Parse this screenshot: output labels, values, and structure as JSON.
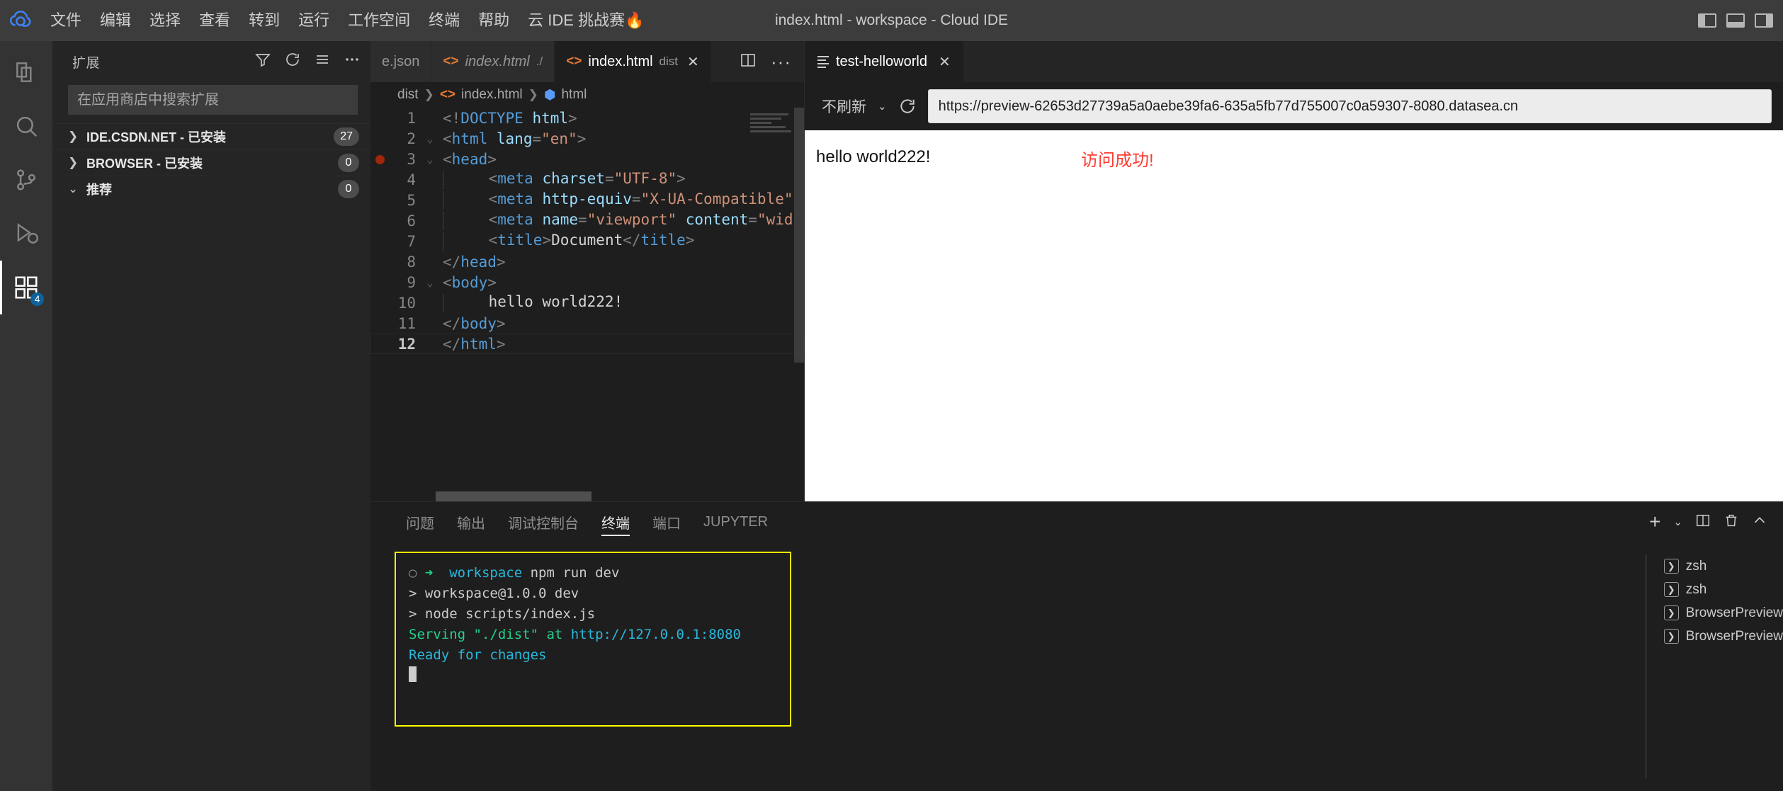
{
  "titlebar": {
    "logo_name": "cloud-ide-logo",
    "window_title": "index.html - workspace - Cloud IDE",
    "menus": [
      "文件",
      "编辑",
      "选择",
      "查看",
      "转到",
      "运行",
      "工作空间",
      "终端",
      "帮助",
      "云 IDE 挑战赛🔥"
    ]
  },
  "activitybar": {
    "items": [
      {
        "name": "explorer",
        "icon": "files-icon",
        "badge": ""
      },
      {
        "name": "search",
        "icon": "search-icon",
        "badge": ""
      },
      {
        "name": "source-control",
        "icon": "source-control-icon",
        "badge": ""
      },
      {
        "name": "run-and-debug",
        "icon": "debug-icon",
        "badge": ""
      },
      {
        "name": "extensions",
        "icon": "extensions-icon",
        "badge": "4"
      }
    ]
  },
  "sidebar": {
    "title": "扩展",
    "actions": [
      "filter-icon",
      "refresh-icon",
      "list-icon",
      "more-icon"
    ],
    "search_placeholder": "在应用商店中搜索扩展",
    "search_value": "",
    "sections": [
      {
        "label": "IDE.CSDN.NET - 已安装",
        "count": "27",
        "expanded": false
      },
      {
        "label": "BROWSER - 已安装",
        "count": "0",
        "expanded": false
      },
      {
        "label": "推荐",
        "count": "0",
        "expanded": true
      }
    ]
  },
  "editor": {
    "tabs": [
      {
        "label": "e.json",
        "desc": "",
        "icon": "",
        "active": false,
        "italic": false,
        "partial": true
      },
      {
        "label": "index.html",
        "desc": "./",
        "icon": "html-icon",
        "active": false,
        "italic": true,
        "partial": false
      },
      {
        "label": "index.html",
        "desc": "dist",
        "icon": "html-icon",
        "active": true,
        "italic": false,
        "partial": false
      }
    ],
    "tab_close_label": "✕",
    "actions": [
      "split-editor-icon",
      "more-actions-icon"
    ],
    "breadcrumb": [
      "dist",
      "index.html",
      "html"
    ],
    "code_lines": [
      {
        "num": "1",
        "fold": "",
        "breakpoint": false,
        "indent": 0,
        "tokens": [
          {
            "t": "&lt;!",
            "c": "tk-br"
          },
          {
            "t": "DOCTYPE",
            "c": "tk-doctype"
          },
          {
            "t": " ",
            "c": "tk-txt"
          },
          {
            "t": "html",
            "c": "tk-doc-name"
          },
          {
            "t": "&gt;",
            "c": "tk-br"
          }
        ]
      },
      {
        "num": "2",
        "fold": "chevron-down",
        "breakpoint": false,
        "indent": 0,
        "tokens": [
          {
            "t": "&lt;",
            "c": "tk-br"
          },
          {
            "t": "html",
            "c": "tk-tag"
          },
          {
            "t": " ",
            "c": "tk-txt"
          },
          {
            "t": "lang",
            "c": "tk-attr"
          },
          {
            "t": "=",
            "c": "tk-br"
          },
          {
            "t": "\"en\"",
            "c": "tk-str"
          },
          {
            "t": "&gt;",
            "c": "tk-br"
          }
        ]
      },
      {
        "num": "3",
        "fold": "chevron-down",
        "breakpoint": true,
        "indent": 0,
        "tokens": [
          {
            "t": "&lt;",
            "c": "tk-br"
          },
          {
            "t": "head",
            "c": "tk-tag"
          },
          {
            "t": "&gt;",
            "c": "tk-br"
          }
        ]
      },
      {
        "num": "4",
        "fold": "",
        "breakpoint": false,
        "indent": 1,
        "tokens": [
          {
            "t": "    &lt;",
            "c": "tk-br"
          },
          {
            "t": "meta",
            "c": "tk-tag"
          },
          {
            "t": " ",
            "c": "tk-txt"
          },
          {
            "t": "charset",
            "c": "tk-attr"
          },
          {
            "t": "=",
            "c": "tk-br"
          },
          {
            "t": "\"UTF-8\"",
            "c": "tk-str"
          },
          {
            "t": "&gt;",
            "c": "tk-br"
          }
        ]
      },
      {
        "num": "5",
        "fold": "",
        "breakpoint": false,
        "indent": 1,
        "tokens": [
          {
            "t": "    &lt;",
            "c": "tk-br"
          },
          {
            "t": "meta",
            "c": "tk-tag"
          },
          {
            "t": " ",
            "c": "tk-txt"
          },
          {
            "t": "http-equiv",
            "c": "tk-attr"
          },
          {
            "t": "=",
            "c": "tk-br"
          },
          {
            "t": "\"X-UA-Compatible\"",
            "c": "tk-str"
          }
        ]
      },
      {
        "num": "6",
        "fold": "",
        "breakpoint": false,
        "indent": 1,
        "tokens": [
          {
            "t": "    &lt;",
            "c": "tk-br"
          },
          {
            "t": "meta",
            "c": "tk-tag"
          },
          {
            "t": " ",
            "c": "tk-txt"
          },
          {
            "t": "name",
            "c": "tk-attr"
          },
          {
            "t": "=",
            "c": "tk-br"
          },
          {
            "t": "\"viewport\"",
            "c": "tk-str"
          },
          {
            "t": " ",
            "c": "tk-txt"
          },
          {
            "t": "content",
            "c": "tk-attr"
          },
          {
            "t": "=",
            "c": "tk-br"
          },
          {
            "t": "\"wid",
            "c": "tk-str"
          }
        ]
      },
      {
        "num": "7",
        "fold": "",
        "breakpoint": false,
        "indent": 1,
        "tokens": [
          {
            "t": "    &lt;",
            "c": "tk-br"
          },
          {
            "t": "title",
            "c": "tk-tag"
          },
          {
            "t": "&gt;",
            "c": "tk-br"
          },
          {
            "t": "Document",
            "c": "tk-txt"
          },
          {
            "t": "&lt;/",
            "c": "tk-br"
          },
          {
            "t": "title",
            "c": "tk-tag"
          },
          {
            "t": "&gt;",
            "c": "tk-br"
          }
        ]
      },
      {
        "num": "8",
        "fold": "",
        "breakpoint": false,
        "indent": 0,
        "tokens": [
          {
            "t": "&lt;/",
            "c": "tk-br"
          },
          {
            "t": "head",
            "c": "tk-tag"
          },
          {
            "t": "&gt;",
            "c": "tk-br"
          }
        ]
      },
      {
        "num": "9",
        "fold": "chevron-down",
        "breakpoint": false,
        "indent": 0,
        "tokens": [
          {
            "t": "&lt;",
            "c": "tk-br"
          },
          {
            "t": "body",
            "c": "tk-tag"
          },
          {
            "t": "&gt;",
            "c": "tk-br"
          }
        ]
      },
      {
        "num": "10",
        "fold": "",
        "breakpoint": false,
        "indent": 1,
        "tokens": [
          {
            "t": "    hello world222!",
            "c": "tk-txt"
          }
        ]
      },
      {
        "num": "11",
        "fold": "",
        "breakpoint": false,
        "indent": 0,
        "tokens": [
          {
            "t": "&lt;/",
            "c": "tk-br"
          },
          {
            "t": "body",
            "c": "tk-tag"
          },
          {
            "t": "&gt;",
            "c": "tk-br"
          }
        ]
      },
      {
        "num": "12",
        "fold": "",
        "breakpoint": false,
        "indent": 0,
        "current": true,
        "tokens": [
          {
            "t": "&lt;/",
            "c": "tk-br"
          },
          {
            "t": "html",
            "c": "tk-tag"
          },
          {
            "t": "&gt;",
            "c": "tk-br"
          }
        ]
      }
    ]
  },
  "preview": {
    "tab_label": "test-helloworld",
    "tab_close": "✕",
    "refresh_mode": "不刷新",
    "reload_icon": "reload-icon",
    "url": "https://preview-62653d27739a5a0aebe39fa6-635a5fb77d755007c0a59307-8080.datasea.cn",
    "content_text": "hello world222!",
    "success_text": "访问成功!",
    "success_color": "#ff3b30"
  },
  "panel": {
    "tabs": [
      "问题",
      "输出",
      "调试控制台",
      "终端",
      "端口",
      "JUPYTER"
    ],
    "active_tab": "终端",
    "actions": [
      "add-terminal-icon",
      "chevron-down-icon",
      "split-terminal-icon",
      "trash-icon",
      "maximize-panel-icon",
      "close-panel-icon"
    ],
    "terminal_border_color": "#ffff00",
    "terminal_lines": [
      {
        "segs": [
          {
            "t": "○ ",
            "c": "t-dim"
          },
          {
            "t": "➜  ",
            "c": "t-green"
          },
          {
            "t": "workspace",
            "c": "t-cyan"
          },
          {
            "t": " npm run dev",
            "c": "t-white"
          }
        ]
      },
      {
        "segs": [
          {
            "t": "",
            "c": "t-white"
          }
        ]
      },
      {
        "segs": [
          {
            "t": "> workspace@1.0.0 dev",
            "c": "t-white"
          }
        ]
      },
      {
        "segs": [
          {
            "t": "> node scripts/index.js",
            "c": "t-white"
          }
        ]
      },
      {
        "segs": [
          {
            "t": "",
            "c": "t-white"
          }
        ]
      },
      {
        "segs": [
          {
            "t": "Serving \"./dist\" at ",
            "c": "t-green"
          },
          {
            "t": "http://127.0.0.1:8080",
            "c": "t-cyan"
          }
        ]
      },
      {
        "segs": [
          {
            "t": "Ready for changes",
            "c": "t-cyan"
          }
        ]
      }
    ],
    "terminal_instances": [
      {
        "label": "zsh",
        "icon": "terminal-icon"
      },
      {
        "label": "zsh",
        "icon": "terminal-icon"
      },
      {
        "label": "BrowserPreview",
        "icon": "terminal-icon"
      },
      {
        "label": "BrowserPreview",
        "icon": "terminal-icon"
      }
    ]
  }
}
